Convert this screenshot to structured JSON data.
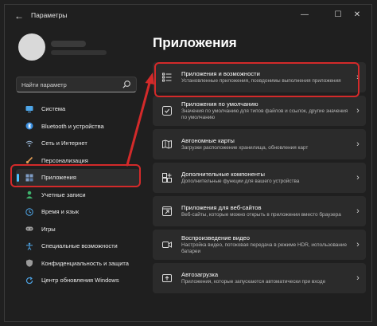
{
  "window": {
    "title": "Параметры",
    "back_glyph": "←",
    "min_glyph": "—",
    "max_glyph": "☐",
    "close_glyph": "✕"
  },
  "search": {
    "placeholder": "Найти параметр",
    "icon": "search-icon"
  },
  "sidebar": {
    "items": [
      {
        "label": "Система",
        "icon": "monitor-icon",
        "color": "#4ea6e8"
      },
      {
        "label": "Bluetooth и устройства",
        "icon": "bluetooth-icon",
        "color": "#3b8fe0"
      },
      {
        "label": "Сеть и Интернет",
        "icon": "wifi-icon",
        "color": "#9ab8d8"
      },
      {
        "label": "Персонализация",
        "icon": "brush-icon",
        "color": "#e09a53"
      },
      {
        "label": "Приложения",
        "icon": "apps-icon",
        "color": "#7e9cc4",
        "active": true
      },
      {
        "label": "Учетные записи",
        "icon": "person-icon",
        "color": "#3fb36d"
      },
      {
        "label": "Время и язык",
        "icon": "globe-clock-icon",
        "color": "#4ea6e8"
      },
      {
        "label": "Игры",
        "icon": "gamepad-icon",
        "color": "#a0a0a0"
      },
      {
        "label": "Специальные возможности",
        "icon": "accessibility-icon",
        "color": "#4ea6e8"
      },
      {
        "label": "Конфиденциальность и защита",
        "icon": "shield-icon",
        "color": "#9a9a9a"
      },
      {
        "label": "Центр обновления Windows",
        "icon": "update-icon",
        "color": "#4ea6e8"
      }
    ]
  },
  "main": {
    "title": "Приложения",
    "cards": [
      {
        "title": "Приложения и возможности",
        "desc": "Установленные приложения, псевдонимы выполнения приложения",
        "icon": "apps-list-icon"
      },
      {
        "title": "Приложения по умолчанию",
        "desc": "Значения по умолчанию для типов файлов и ссылок, другие значения по умолчанию",
        "icon": "default-apps-icon"
      },
      {
        "title": "Автономные карты",
        "desc": "Загрузки расположение хранилища, обновления карт",
        "icon": "map-icon"
      },
      {
        "title": "Дополнительные компоненты",
        "desc": "Дополнительные функции для вашего устройства",
        "icon": "components-icon"
      },
      {
        "title": "Приложения для веб-сайтов",
        "desc": "Веб-сайты, которые можно открыть в приложении вместо браузера",
        "icon": "web-apps-icon"
      },
      {
        "title": "Воспроизведение видео",
        "desc": "Настройка видео, потоковая передача в режиме HDR, использование батареи",
        "icon": "video-icon"
      },
      {
        "title": "Автозагрузка",
        "desc": "Приложения, которые запускаются автоматически при входе",
        "icon": "startup-icon"
      }
    ],
    "chevron": "›"
  },
  "annotation_color": "#d32a2a",
  "accent": "#4cc2ff"
}
